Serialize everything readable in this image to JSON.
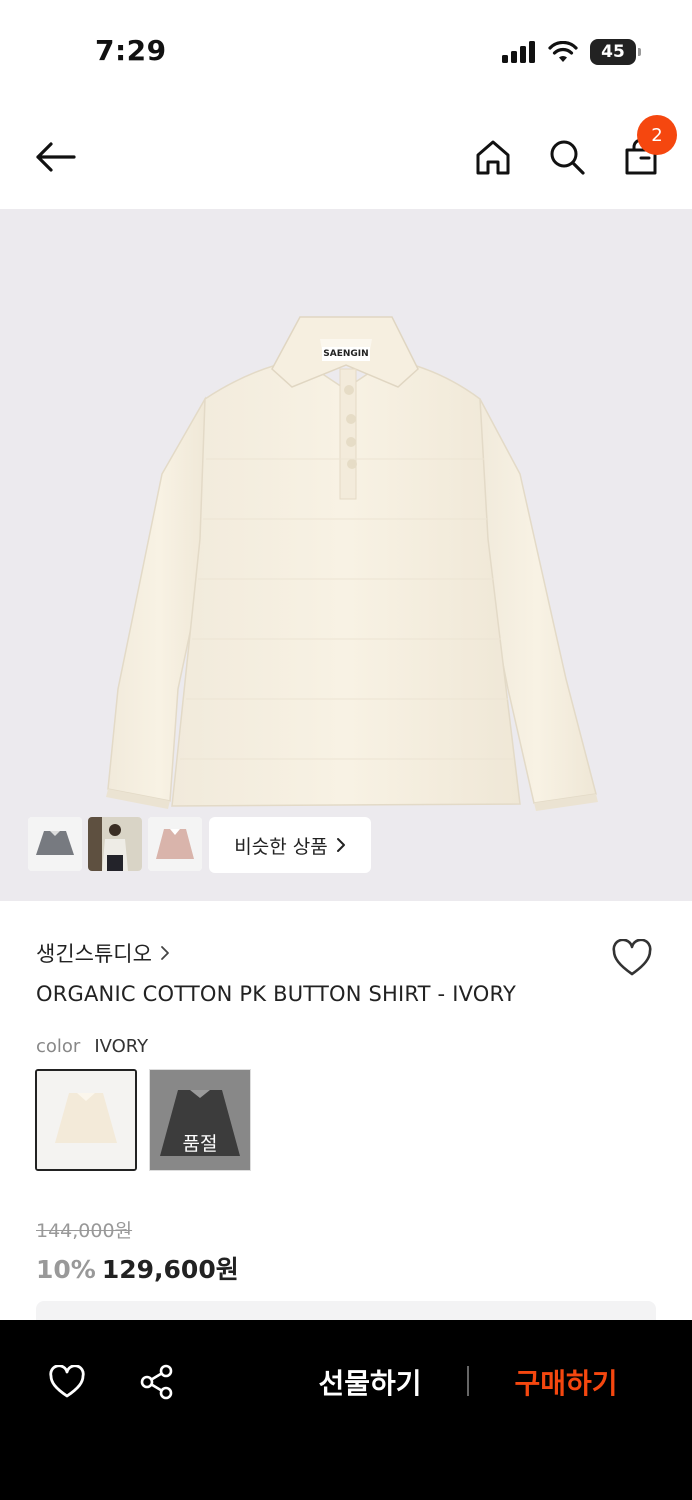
{
  "status_bar": {
    "time": "7:29",
    "battery": "45"
  },
  "header": {
    "cart_count": "2"
  },
  "product_image": {
    "label_text": "SAENGIN",
    "similar_button_label": "비슷한 상품"
  },
  "product": {
    "brand": "생긴스튜디오",
    "name": "ORGANIC COTTON PK BUTTON SHIRT - IVORY",
    "option_label": "color",
    "option_value": "IVORY",
    "swatches": [
      {
        "color": "IVORY",
        "selected": true
      },
      {
        "color": "CHARCOAL",
        "status": "품절"
      }
    ],
    "original_price": "144,000원",
    "discount": "10%",
    "sale_price": "129,600원"
  },
  "bottom_bar": {
    "gift_label": "선물하기",
    "buy_label": "구매하기"
  },
  "colors": {
    "accent": "#f5470f",
    "bottom_bar_bg": "#000000",
    "image_bg": "#eceaee"
  }
}
